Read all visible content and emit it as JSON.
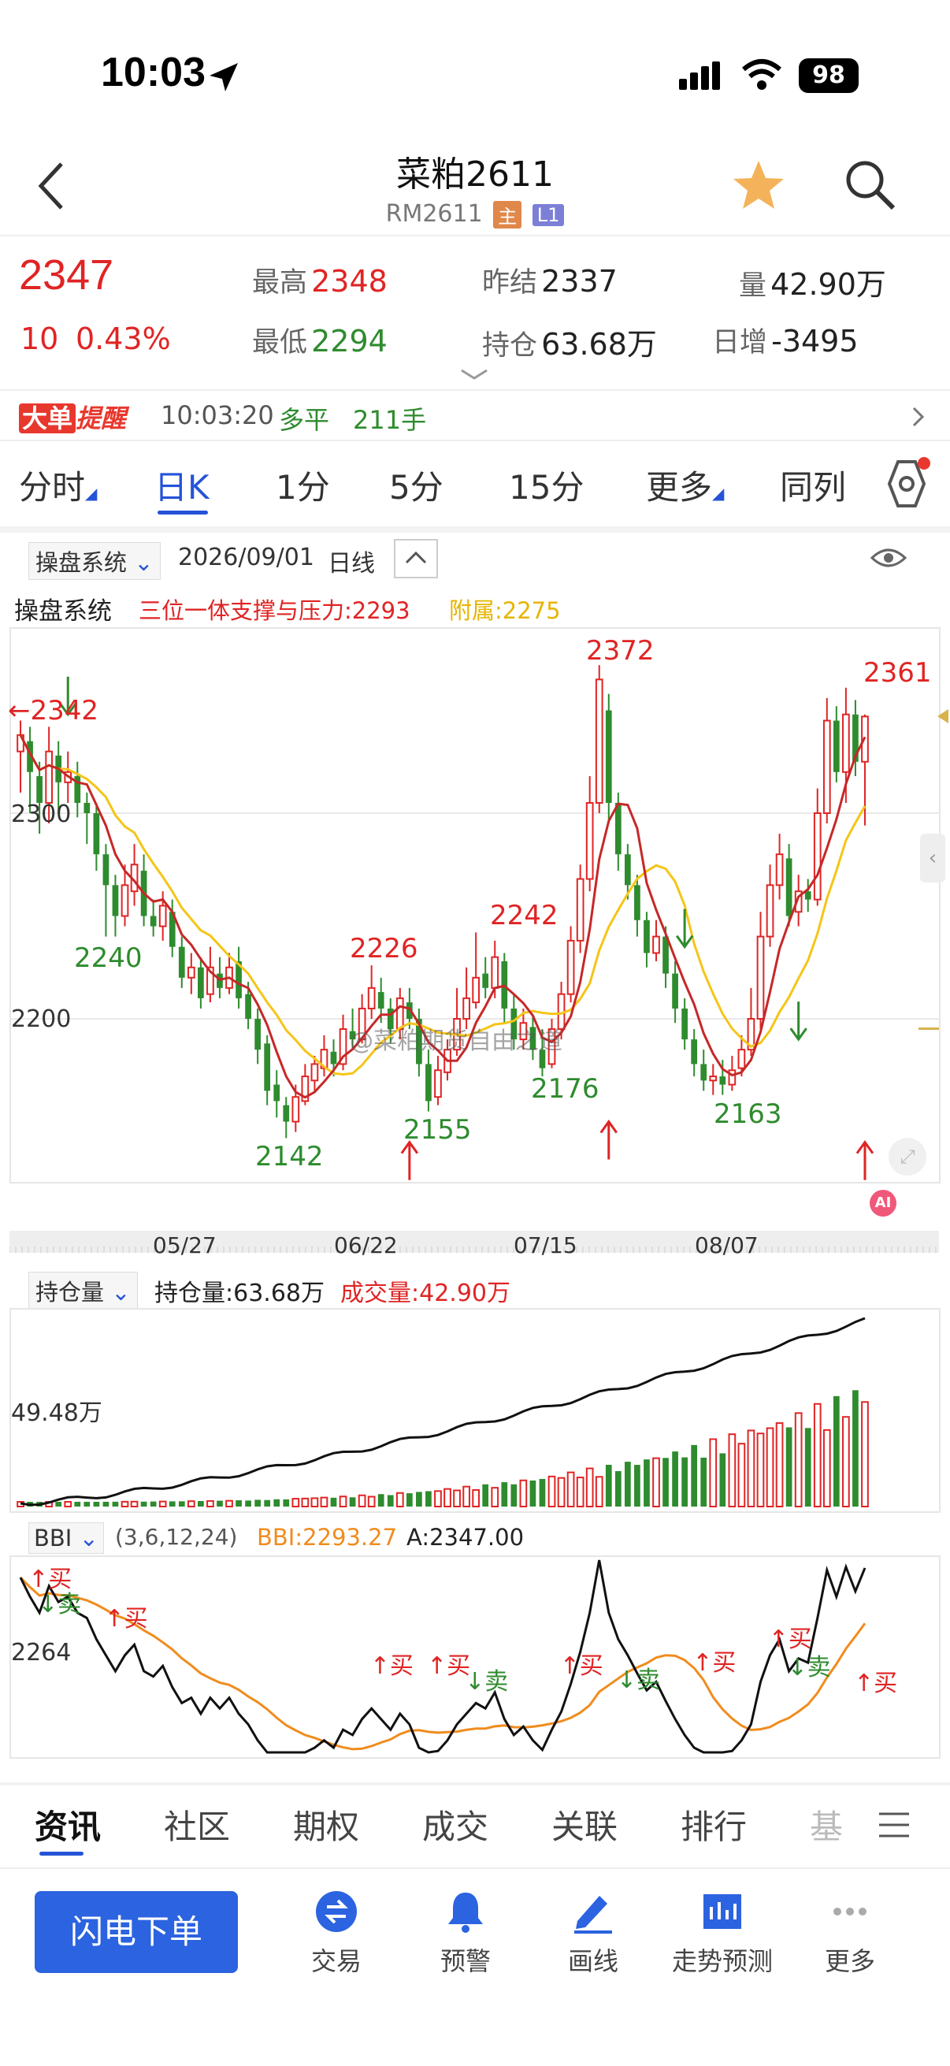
{
  "status_bar": {
    "time": "10:03",
    "battery": "98"
  },
  "header": {
    "title": "菜粕2611",
    "code": "RM2611",
    "tag_main": "主",
    "tag_level": "L1"
  },
  "quote": {
    "price": "2347",
    "change": "10",
    "change_pct": "0.43%",
    "high_label": "最高",
    "high": "2348",
    "low_label": "最低",
    "low": "2294",
    "prev_settle_label": "昨结",
    "prev_settle": "2337",
    "open_interest_label": "持仓",
    "open_interest": "63.68万",
    "volume_label": "量",
    "volume": "42.90万",
    "daily_increase_label": "日增",
    "daily_increase": "-3495"
  },
  "alert": {
    "badge_a": "大单",
    "badge_b": "提醒",
    "time": "10:03:20",
    "type": "多平",
    "qty": "211手"
  },
  "period_tabs": [
    "分时",
    "日K",
    "1分",
    "5分",
    "15分",
    "更多",
    "同列"
  ],
  "chart_toolbar": {
    "system": "操盘系统",
    "date": "2026/09/01",
    "period": "日线"
  },
  "main_chart": {
    "indicator_name": "操盘系统",
    "indicator_support": "三位一体支撑与压力:2293",
    "indicator_aux": "附属:2275",
    "price_labels": [
      "2342",
      "2240",
      "2142",
      "2226",
      "2155",
      "2242",
      "2176",
      "2372",
      "2163",
      "2361"
    ],
    "y_ticks": [
      "2300",
      "2200"
    ],
    "x_ticks": [
      "05/27",
      "06/22",
      "07/15",
      "08/07"
    ],
    "watermark": "@菜粕期货自由之道",
    "ai_badge": "AI"
  },
  "oi_panel": {
    "selector": "持仓量",
    "oi_label": "持仓量:63.68万",
    "vol_label": "成交量:42.90万",
    "y_tick": "49.48万"
  },
  "bbi_panel": {
    "selector": "BBI",
    "params": "(3,6,12,24)",
    "bbi_label": "BBI:2293.27",
    "a_label": "A:2347.00",
    "y_tick": "2264",
    "marks": {
      "buy": "买",
      "sell": "卖"
    }
  },
  "bottom_tabs": [
    "资讯",
    "社区",
    "期权",
    "成交",
    "关联",
    "排行",
    "基"
  ],
  "toolbar": {
    "quick_order": "闪电下单",
    "trade": "交易",
    "alert": "预警",
    "draw": "画线",
    "forecast": "走势预测",
    "more": "更多"
  },
  "colors": {
    "up": "#e02424",
    "down": "#2e8b2e",
    "accent": "#2553d8",
    "ma_red": "#c62828",
    "ma_yellow": "#f5c518",
    "bbi_orange": "#f08c1e"
  },
  "chart_data": {
    "type": "candlestick",
    "x_ticks": [
      "05/27",
      "06/22",
      "07/15",
      "08/07"
    ],
    "y_ticks": [
      2300,
      2200
    ],
    "candles": [
      [
        2330,
        2338,
        2345,
        2310
      ],
      [
        2335,
        2320,
        2342,
        2300
      ],
      [
        2318,
        2305,
        2325,
        2290
      ],
      [
        2305,
        2330,
        2342,
        2295
      ],
      [
        2328,
        2315,
        2335,
        2300
      ],
      [
        2315,
        2320,
        2330,
        2305
      ],
      [
        2318,
        2305,
        2325,
        2298
      ],
      [
        2305,
        2300,
        2310,
        2285
      ],
      [
        2300,
        2280,
        2305,
        2272
      ],
      [
        2280,
        2265,
        2285,
        2240
      ],
      [
        2265,
        2250,
        2270,
        2240
      ],
      [
        2250,
        2265,
        2275,
        2245
      ],
      [
        2262,
        2275,
        2285,
        2255
      ],
      [
        2272,
        2250,
        2280,
        2245
      ],
      [
        2250,
        2245,
        2258,
        2240
      ],
      [
        2245,
        2255,
        2262,
        2238
      ],
      [
        2252,
        2235,
        2258,
        2230
      ],
      [
        2235,
        2220,
        2240,
        2215
      ],
      [
        2220,
        2225,
        2232,
        2212
      ],
      [
        2225,
        2210,
        2230,
        2205
      ],
      [
        2212,
        2225,
        2235,
        2208
      ],
      [
        2222,
        2215,
        2230,
        2210
      ],
      [
        2215,
        2225,
        2232,
        2212
      ],
      [
        2228,
        2210,
        2235,
        2205
      ],
      [
        2212,
        2200,
        2218,
        2195
      ],
      [
        2200,
        2185,
        2205,
        2178
      ],
      [
        2188,
        2165,
        2192,
        2158
      ],
      [
        2168,
        2160,
        2175,
        2152
      ],
      [
        2158,
        2150,
        2162,
        2142
      ],
      [
        2150,
        2162,
        2168,
        2145
      ],
      [
        2160,
        2172,
        2178,
        2158
      ],
      [
        2170,
        2178,
        2182,
        2165
      ],
      [
        2176,
        2185,
        2192,
        2172
      ],
      [
        2184,
        2178,
        2190,
        2172
      ],
      [
        2178,
        2195,
        2202,
        2175
      ],
      [
        2194,
        2190,
        2205,
        2185
      ],
      [
        2190,
        2205,
        2212,
        2188
      ],
      [
        2205,
        2215,
        2226,
        2200
      ],
      [
        2213,
        2205,
        2220,
        2198
      ],
      [
        2205,
        2195,
        2210,
        2188
      ],
      [
        2195,
        2210,
        2215,
        2190
      ],
      [
        2208,
        2200,
        2215,
        2195
      ],
      [
        2200,
        2178,
        2205,
        2172
      ],
      [
        2178,
        2160,
        2185,
        2155
      ],
      [
        2162,
        2175,
        2182,
        2158
      ],
      [
        2174,
        2185,
        2190,
        2170
      ],
      [
        2185,
        2200,
        2215,
        2182
      ],
      [
        2200,
        2210,
        2225,
        2195
      ],
      [
        2208,
        2220,
        2242,
        2205
      ],
      [
        2222,
        2215,
        2230,
        2210
      ],
      [
        2215,
        2230,
        2238,
        2210
      ],
      [
        2228,
        2205,
        2232,
        2198
      ],
      [
        2205,
        2190,
        2212,
        2185
      ],
      [
        2190,
        2198,
        2205,
        2185
      ],
      [
        2196,
        2185,
        2202,
        2180
      ],
      [
        2185,
        2176,
        2195,
        2172
      ],
      [
        2178,
        2195,
        2200,
        2176
      ],
      [
        2195,
        2212,
        2218,
        2190
      ],
      [
        2212,
        2238,
        2245,
        2208
      ],
      [
        2238,
        2268,
        2275,
        2232
      ],
      [
        2268,
        2305,
        2318,
        2262
      ],
      [
        2305,
        2365,
        2372,
        2300
      ],
      [
        2350,
        2305,
        2358,
        2295
      ],
      [
        2305,
        2280,
        2310,
        2272
      ],
      [
        2280,
        2265,
        2285,
        2258
      ],
      [
        2265,
        2248,
        2270,
        2240
      ],
      [
        2248,
        2232,
        2252,
        2225
      ],
      [
        2232,
        2240,
        2248,
        2228
      ],
      [
        2240,
        2222,
        2245,
        2215
      ],
      [
        2222,
        2205,
        2228,
        2198
      ],
      [
        2205,
        2190,
        2210,
        2185
      ],
      [
        2190,
        2178,
        2195,
        2172
      ],
      [
        2178,
        2170,
        2185,
        2165
      ],
      [
        2170,
        2172,
        2178,
        2163
      ],
      [
        2172,
        2168,
        2180,
        2163
      ],
      [
        2168,
        2175,
        2182,
        2165
      ],
      [
        2176,
        2185,
        2192,
        2172
      ],
      [
        2185,
        2200,
        2215,
        2182
      ],
      [
        2200,
        2240,
        2252,
        2195
      ],
      [
        2240,
        2265,
        2275,
        2235
      ],
      [
        2265,
        2280,
        2290,
        2258
      ],
      [
        2278,
        2250,
        2285,
        2245
      ],
      [
        2252,
        2262,
        2270,
        2245
      ],
      [
        2262,
        2258,
        2268,
        2252
      ],
      [
        2258,
        2300,
        2312,
        2255
      ],
      [
        2300,
        2345,
        2356,
        2295
      ],
      [
        2345,
        2320,
        2352,
        2315
      ],
      [
        2320,
        2348,
        2361,
        2305
      ],
      [
        2348,
        2325,
        2355,
        2318
      ],
      [
        2325,
        2347,
        2348,
        2294
      ]
    ]
  }
}
